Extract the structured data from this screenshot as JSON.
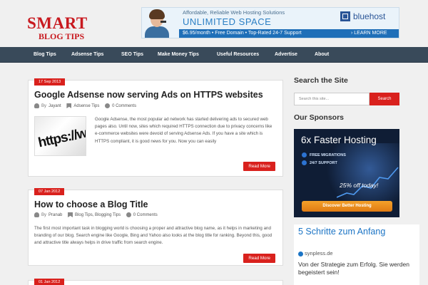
{
  "logo": {
    "line1": "SMART",
    "line2": "BLOG TIPS"
  },
  "banner": {
    "line1": "Affordable, Reliable Web Hosting Solutions",
    "line2": "UNLIMITED SPACE",
    "line3": "$6.95/month  •  Free Domain  •  Top-Rated 24-7 Support",
    "brand": "bluehost",
    "cta": "› LEARN MORE"
  },
  "nav": {
    "items": [
      "Blog Tips",
      "Adsense Tips",
      "SEO Tips",
      "Make Money Tips",
      "Useful Resources",
      "Advertise",
      "About"
    ]
  },
  "posts": [
    {
      "date": "17 Sep 2013",
      "title": "Google Adsense now serving Ads on HTTPS websites",
      "by": "By",
      "author": "Jayant",
      "categories": "Adsense Tips",
      "comments": "0 Comments",
      "thumb_text": "https://ww",
      "excerpt": "Google Adsense, the most popular ad network has started delivering ads to secured web pages also. Until now, sites which required HTTPS connection due to privacy concerns like e-commerce websites were devoid of serving Adsense Ads. If you have a site which is HTTPS compliant, it is good news for you. Now you can easily",
      "read_more": "Read More"
    },
    {
      "date": "07 Jan 2012",
      "title": "How to choose a Blog Title",
      "by": "By",
      "author": "Pranab",
      "categories": "Blog Tips, Blogging Tips",
      "comments": "0 Comments",
      "excerpt": "The first most important task in blogging world is choosing a proper and attractive blog name, as it helps in marketing and branding of our blog. Search engine like Google, Bing and Yahoo also looks at the blog title for ranking. Beyond this, good and attractive title always helps in drive traffic from search engine.",
      "read_more": "Read More"
    },
    {
      "date": "01 Jan 2012"
    }
  ],
  "sidebar": {
    "search_title": "Search the Site",
    "search_placeholder": "Search this site...",
    "search_button": "Search",
    "sponsors_title": "Our Sponsors",
    "sponsor_ad": {
      "headline": "6x Faster Hosting",
      "feature1": "FREE MIGRATIONS",
      "feature2": "24/7 SUPPORT",
      "offer": "25% off today!",
      "cta": "Discover Better Hosting"
    },
    "text_ad": {
      "title": "5 Schritte zum Anfang",
      "url": "synpless.de",
      "body": "Von der Strategie zum Erfolg. Sie werden begeistert sein!"
    }
  },
  "colors": {
    "accent": "#d9211d",
    "nav_bg": "#394a5a",
    "link": "#1b74c5"
  }
}
